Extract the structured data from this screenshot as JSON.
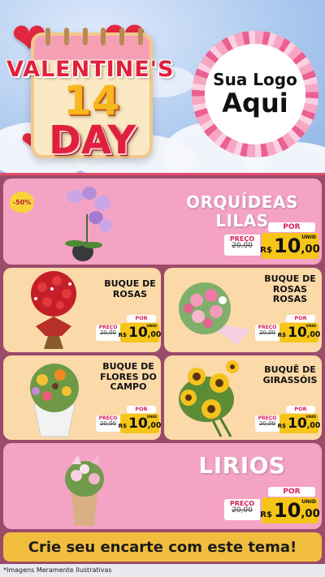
{
  "header": {
    "title_top": "VALENTINE'S",
    "title_number": "14",
    "title_bottom": "DAY",
    "logo_line1": "Sua Logo",
    "logo_line2": "Aqui"
  },
  "price_labels": {
    "por": "POR",
    "preco": "PREÇO",
    "rs": "R$",
    "unid": "UNID"
  },
  "products": [
    {
      "name": "ORQUÍDEAS LILAS",
      "badge": "-50%",
      "old_price": "20,00",
      "price_int": "10",
      "price_cents": ",00"
    },
    {
      "name": "BUQUE DE ROSAS",
      "old_price": "20,00",
      "price_int": "10",
      "price_cents": ",00"
    },
    {
      "name": "BUQUE DE ROSAS ROSAS",
      "old_price": "20,00",
      "price_int": "10",
      "price_cents": ",00"
    },
    {
      "name": "BUQUE DE FLORES DO CAMPO",
      "old_price": "20,00",
      "price_int": "10",
      "price_cents": ",00"
    },
    {
      "name": "BUQUÊ DE GIRASSÓIS",
      "old_price": "20,00",
      "price_int": "10",
      "price_cents": ",00"
    },
    {
      "name": "LIRIOS",
      "old_price": "20,00",
      "price_int": "10",
      "price_cents": ",00"
    }
  ],
  "cta": "Crie seu encarte com este tema!",
  "footnote": "*Imagens Meramente Ilustrativas",
  "colors": {
    "accent_pink": "#f4a3c5",
    "accent_cream": "#fbd9a9",
    "price_yellow": "#f5c518",
    "brand_red": "#e0203c"
  }
}
